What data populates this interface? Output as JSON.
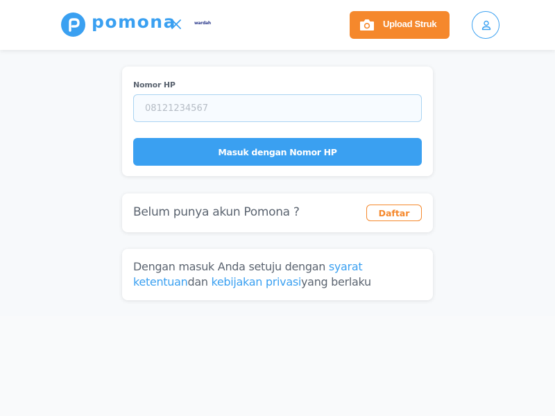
{
  "header": {
    "brand_name": "pomona",
    "partner_name": "wardah",
    "upload_label": "Upload Struk",
    "icons": {
      "brand": "pomona-logo-icon",
      "times": "times-icon",
      "camera": "camera-icon",
      "user": "user-icon"
    }
  },
  "login": {
    "phone_label": "Nomor HP",
    "phone_placeholder": "08121234567",
    "phone_value": "",
    "submit_label": "Masuk dengan Nomor HP"
  },
  "register": {
    "prompt": "Belum punya akun Pomona ?",
    "button_label": "Daftar"
  },
  "terms": {
    "prefix": "Dengan masuk Anda setuju dengan ",
    "link_terms": "syarat ketentuan",
    "middle": "dan ",
    "link_privacy": "kebijakan privasi",
    "suffix": "yang berlaku"
  },
  "colors": {
    "brand_blue": "#3aa0f1",
    "accent_orange": "#f5882c",
    "text": "#5b6470",
    "background": "#f7f9fb"
  }
}
